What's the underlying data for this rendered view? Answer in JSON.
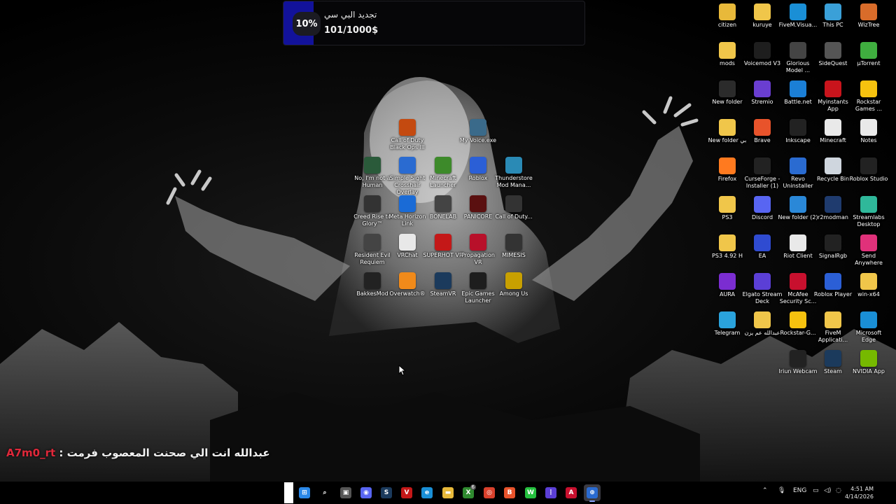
{
  "notification": {
    "percent": "10%",
    "title": "تجديد البي سي",
    "value": "101/1000$",
    "progress": 0.1
  },
  "chat": {
    "user": "A7m0_rt",
    "separator": " : ",
    "message": "عبدالله انت الي صحنت المعصوب فرمت"
  },
  "desktop_icons_right": [
    {
      "label": "citizen",
      "icon": "folder-icon",
      "color": "#e8b93a"
    },
    {
      "label": "kuruye",
      "icon": "folder-icon",
      "color": "#f0c64a"
    },
    {
      "label": "FiveM.Visua...",
      "icon": "edge-icon",
      "color": "#1a8fd6"
    },
    {
      "label": "This PC",
      "icon": "monitor-icon",
      "color": "#3aa0d8"
    },
    {
      "label": "WizTree",
      "icon": "wiztree-icon",
      "color": "#d96c2a"
    },
    {
      "label": "mods",
      "icon": "folder-icon",
      "color": "#f0c64a"
    },
    {
      "label": "Voicemod V3",
      "icon": "voicemod-icon",
      "color": "#1e1e1e"
    },
    {
      "label": "Glorious Model ...",
      "icon": "mouse-icon",
      "color": "#444"
    },
    {
      "label": "SideQuest",
      "icon": "sidequest-icon",
      "color": "#555"
    },
    {
      "label": "µTorrent",
      "icon": "utorrent-icon",
      "color": "#3fae3f"
    },
    {
      "label": "New folder",
      "icon": "folder-icon",
      "color": "#2b2b2b"
    },
    {
      "label": "Stremio",
      "icon": "stremio-icon",
      "color": "#6a3ed1"
    },
    {
      "label": "Battle.net",
      "icon": "battlenet-icon",
      "color": "#1b7fd6"
    },
    {
      "label": "Myinstants App",
      "icon": "myinstants-icon",
      "color": "#c9141c"
    },
    {
      "label": "Rockstar Games ...",
      "icon": "rockstar-icon",
      "color": "#f6c20f"
    },
    {
      "label": "New folder بي",
      "icon": "folder-icon",
      "color": "#f0c64a"
    },
    {
      "label": "Brave",
      "icon": "brave-icon",
      "color": "#e8532b"
    },
    {
      "label": "Inkscape",
      "icon": "inkscape-icon",
      "color": "#222"
    },
    {
      "label": "Minecraft",
      "icon": "file-icon",
      "color": "#e9e9e9"
    },
    {
      "label": "Notes",
      "icon": "notes-icon",
      "color": "#e9e9e9"
    },
    {
      "label": "Firefox",
      "icon": "firefox-icon",
      "color": "#ff7a1f"
    },
    {
      "label": "CurseForge - Installer (1)",
      "icon": "curseforge-icon",
      "color": "#222"
    },
    {
      "label": "Revo Uninstaller",
      "icon": "revo-icon",
      "color": "#2a6bd1"
    },
    {
      "label": "Recycle Bin",
      "icon": "recycle-bin-icon",
      "color": "#cfd6de"
    },
    {
      "label": "Roblox Studio",
      "icon": "roblox-studio-icon",
      "color": "#222"
    },
    {
      "label": "PS3",
      "icon": "folder-icon",
      "color": "#f0c64a"
    },
    {
      "label": "Discord",
      "icon": "discord-icon",
      "color": "#5865f2"
    },
    {
      "label": "New folder (2)",
      "icon": "folder-icon",
      "color": "#2a88d8"
    },
    {
      "label": "r2modman",
      "icon": "r2modman-icon",
      "color": "#1f3b6e"
    },
    {
      "label": "Streamlabs Desktop",
      "icon": "streamlabs-icon",
      "color": "#2fb89a"
    },
    {
      "label": "PS3 4.92 H",
      "icon": "folder-icon",
      "color": "#f0c64a"
    },
    {
      "label": "EA",
      "icon": "ea-icon",
      "color": "#2f4bd1"
    },
    {
      "label": "Riot Client",
      "icon": "file-icon",
      "color": "#e9e9e9"
    },
    {
      "label": "SignalRgb",
      "icon": "signalrgb-icon",
      "color": "#222"
    },
    {
      "label": "Send Anywhere",
      "icon": "sendanywhere-icon",
      "color": "#e0317a"
    },
    {
      "label": "AURA",
      "icon": "aura-icon",
      "color": "#7b2dd1"
    },
    {
      "label": "Elgato Stream Deck",
      "icon": "streamdeck-icon",
      "color": "#5b3fd6"
    },
    {
      "label": "McAfee Security Sc...",
      "icon": "mcafee-icon",
      "color": "#c8102e"
    },
    {
      "label": "Roblox Player",
      "icon": "roblox-icon",
      "color": "#2b5fd6"
    },
    {
      "label": "win-x64",
      "icon": "folder-icon",
      "color": "#f0c64a"
    },
    {
      "label": "Telegram",
      "icon": "telegram-icon",
      "color": "#2aa3dd"
    },
    {
      "label": "عبدالله عم يزن",
      "icon": "folder-icon",
      "color": "#f0c64a"
    },
    {
      "label": "Rockstar-G...",
      "icon": "rockstar-icon",
      "color": "#f6c20f"
    },
    {
      "label": "FiveM Applicati...",
      "icon": "folder-icon",
      "color": "#f0c64a"
    },
    {
      "label": "Microsoft Edge",
      "icon": "edge-icon",
      "color": "#1a8fd6"
    },
    {
      "label": "Iriun Webcam",
      "icon": "webcam-icon",
      "color": "#222"
    },
    {
      "label": "Steam",
      "icon": "steam-icon",
      "color": "#1b3a5c"
    },
    {
      "label": "NVIDIA App",
      "icon": "nvidia-icon",
      "color": "#76b900"
    }
  ],
  "desktop_icons_center": [
    {
      "label": "Call of Duty Black Ops III",
      "icon": "cod-icon",
      "color": "#c44a10"
    },
    {
      "label": "My Voice.exe",
      "icon": "myvoice-icon",
      "color": "#3a6a8a"
    },
    {
      "label": "No, I'm not a Human",
      "icon": "game-icon",
      "color": "#2a5a3a"
    },
    {
      "label": "Simple Sight Crosshair Overlay",
      "icon": "crosshair-icon",
      "color": "#2a6bd1"
    },
    {
      "label": "Minecraft Launcher",
      "icon": "minecraft-icon",
      "color": "#3d8a2a"
    },
    {
      "label": "Roblox",
      "icon": "roblox-icon",
      "color": "#2b5fd6"
    },
    {
      "label": "Thunderstore Mod Mana...",
      "icon": "thunderstore-icon",
      "color": "#2a8ab5"
    },
    {
      "label": "Creed Rise to Glory™",
      "icon": "creed-icon",
      "color": "#333"
    },
    {
      "label": "Meta Horizon Link",
      "icon": "meta-icon",
      "color": "#1a6bd6"
    },
    {
      "label": "BONELAB",
      "icon": "bonelab-icon",
      "color": "#444"
    },
    {
      "label": "PANICORE",
      "icon": "panicore-icon",
      "color": "#5a1010"
    },
    {
      "label": "Call of Duty...",
      "icon": "cod-icon",
      "color": "#333"
    },
    {
      "label": "Resident Evil Requiem",
      "icon": "re-icon",
      "color": "#444"
    },
    {
      "label": "VRChat",
      "icon": "vrchat-icon",
      "color": "#e8e8e8"
    },
    {
      "label": "SUPERHOT VR",
      "icon": "superhot-icon",
      "color": "#c41818"
    },
    {
      "label": "Propagation VR",
      "icon": "propagation-icon",
      "color": "#b8102a"
    },
    {
      "label": "MIMESIS",
      "icon": "mimesis-icon",
      "color": "#333"
    },
    {
      "label": "BakkesMod",
      "icon": "bakkesmod-icon",
      "color": "#222"
    },
    {
      "label": "Overwatch®",
      "icon": "overwatch-icon",
      "color": "#f08a1a"
    },
    {
      "label": "SteamVR",
      "icon": "steamvr-icon",
      "color": "#1b3a5c"
    },
    {
      "label": "Epic Games Launcher",
      "icon": "epic-icon",
      "color": "#1e1e1e"
    },
    {
      "label": "Among Us",
      "icon": "amongus-icon",
      "color": "#c8a000"
    }
  ],
  "taskbar": {
    "apps": [
      {
        "name": "start-icon",
        "glyph": "⊞",
        "color": "#2a88e8"
      },
      {
        "name": "search-icon",
        "glyph": "⌕",
        "color": "transparent"
      },
      {
        "name": "task-view-icon",
        "glyph": "▣",
        "color": "#555"
      },
      {
        "name": "discord-icon",
        "glyph": "◉",
        "color": "#5865f2"
      },
      {
        "name": "steam-icon",
        "glyph": "S",
        "color": "#1b3a5c"
      },
      {
        "name": "vrchat-icon",
        "glyph": "V",
        "color": "#c41818"
      },
      {
        "name": "edge-icon",
        "glyph": "e",
        "color": "#1a8fd6"
      },
      {
        "name": "file-explorer-icon",
        "glyph": "▬",
        "color": "#e8b93a"
      },
      {
        "name": "xbox-icon",
        "glyph": "X",
        "color": "#2f8a2f",
        "badge": "6"
      },
      {
        "name": "chrome-icon",
        "glyph": "◎",
        "color": "#d9412c"
      },
      {
        "name": "brave-icon",
        "glyph": "B",
        "color": "#e8532b"
      },
      {
        "name": "whatsapp-icon",
        "glyph": "W",
        "color": "#25c03e"
      },
      {
        "name": "apps-grid-icon",
        "glyph": "⋮",
        "color": "#5b3fd6"
      },
      {
        "name": "adobe-icon",
        "glyph": "A",
        "color": "#c8102e"
      },
      {
        "name": "crosshair-app-icon",
        "glyph": "⊕",
        "color": "#2a6bd1",
        "active": true
      }
    ],
    "tray": {
      "language": "ENG",
      "time": "4:51 AM",
      "date": "4/14/2026"
    }
  }
}
